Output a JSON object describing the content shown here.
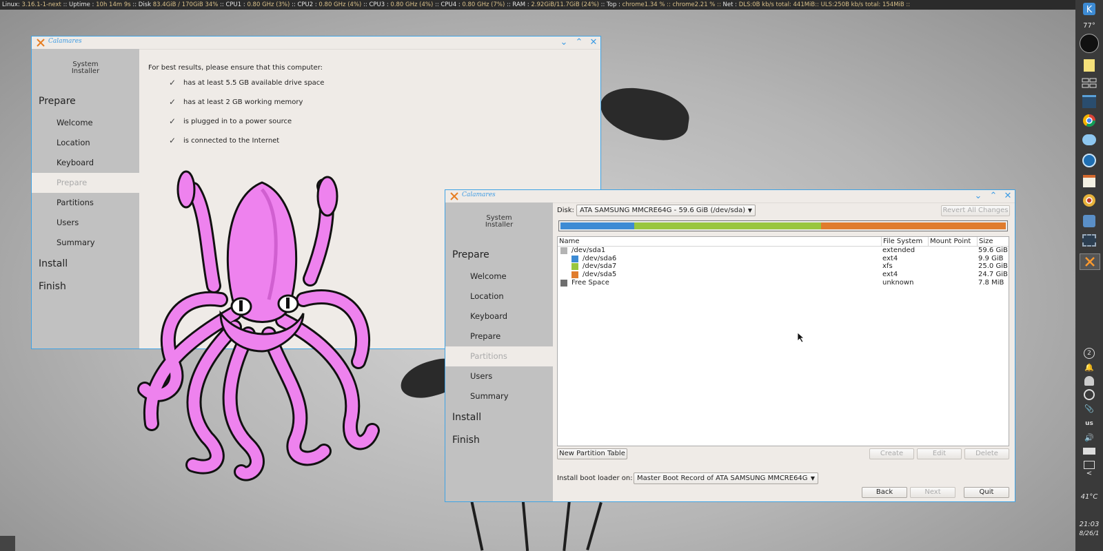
{
  "topbar": {
    "text_parts": [
      {
        "label": "Linux:",
        "value": "3.16.1-1-next"
      },
      {
        "label": ":: Uptime :",
        "value": "10h 14m 9s"
      },
      {
        "label": ":: Disk",
        "value": "83.4GiB / 170GiB 34%"
      },
      {
        "label": ":: CPU1 :",
        "value": "0.80 GHz (3%)"
      },
      {
        "label": ":: CPU2 :",
        "value": "0.80 GHz (4%)"
      },
      {
        "label": ":: CPU3 :",
        "value": "0.80 GHz (4%)"
      },
      {
        "label": ":: CPU4 :",
        "value": "0.80 GHz (7%)"
      },
      {
        "label": ":: RAM :",
        "value": "2.92GiB/11.7GiB (24%)"
      },
      {
        "label": ":: Top :",
        "value": "chrome"
      },
      {
        "label": "",
        "value": "1.34 % :: chrome"
      },
      {
        "label": "",
        "value": "2.21 % ::"
      },
      {
        "label": "Net :",
        "value": "DLS:0B  kb/s  total: 441MiB::  ULS:250B  kb/s  total: 154MiB  ::"
      }
    ]
  },
  "right_panel": {
    "temp_top": "77°",
    "badge": "2",
    "layout": "us",
    "temp_bottom": "41°C",
    "clock_time": "21:03",
    "clock_date": "8/26/1",
    "chevron": "<"
  },
  "win1": {
    "title": "Calamares",
    "sidebar_header_line1": "System",
    "sidebar_header_line2": "Installer",
    "sections": [
      "Prepare",
      "Install",
      "Finish"
    ],
    "items": [
      "Welcome",
      "Location",
      "Keyboard",
      "Prepare",
      "Partitions",
      "Users",
      "Summary"
    ],
    "active_item": "Prepare",
    "intro": "For best results, please ensure that this computer:",
    "requirements": [
      "has at least 5.5 GB available drive space",
      "has at least 2 GB working memory",
      "is plugged in to a power source",
      "is connected to the Internet"
    ]
  },
  "win2": {
    "title": "Calamares",
    "sidebar_header_line1": "System",
    "sidebar_header_line2": "Installer",
    "sections": [
      "Prepare",
      "Install",
      "Finish"
    ],
    "items": [
      "Welcome",
      "Location",
      "Keyboard",
      "Prepare",
      "Partitions",
      "Users",
      "Summary"
    ],
    "active_item": "Partitions",
    "disk_label": "Disk:",
    "disk_value": "ATA SAMSUNG MMCRE64G - 59.6 GiB (/dev/sda)",
    "revert_button": "Revert All Changes",
    "partition_bar": [
      {
        "color": "#3d8bd4",
        "fraction": 0.166
      },
      {
        "color": "#99c63e",
        "fraction": 0.419
      },
      {
        "color": "#e07c2d",
        "fraction": 0.415
      }
    ],
    "columns": [
      "Name",
      "File System",
      "Mount Point",
      "Size"
    ],
    "rows": [
      {
        "name": "/dev/sda1",
        "fs": "extended",
        "mount": "",
        "size": "59.6 GiB",
        "color": "#b4b4b4",
        "indent": 0
      },
      {
        "name": "/dev/sda6",
        "fs": "ext4",
        "mount": "",
        "size": "9.9 GiB",
        "color": "#3d8bd4",
        "indent": 1
      },
      {
        "name": "/dev/sda7",
        "fs": "xfs",
        "mount": "",
        "size": "25.0 GiB",
        "color": "#99c63e",
        "indent": 1
      },
      {
        "name": "/dev/sda5",
        "fs": "ext4",
        "mount": "",
        "size": "24.7 GiB",
        "color": "#e07c2d",
        "indent": 1
      },
      {
        "name": "Free Space",
        "fs": "unknown",
        "mount": "",
        "size": "7.8 MiB",
        "color": "#6e6e6e",
        "indent": 0
      }
    ],
    "new_partition_table_button": "New Partition Table",
    "create_button": "Create",
    "edit_button": "Edit",
    "delete_button": "Delete",
    "bootloader_label": "Install boot loader on:",
    "bootloader_value": "Master Boot Record of ATA SAMSUNG MMCRE64G",
    "back_button": "Back",
    "next_button": "Next",
    "quit_button": "Quit"
  }
}
